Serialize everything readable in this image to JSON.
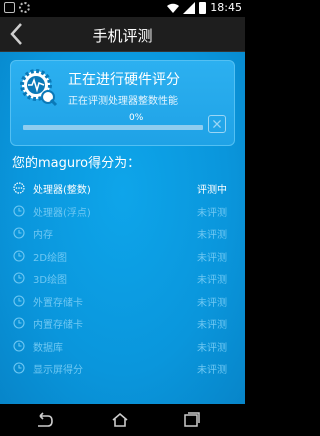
{
  "status_bar": {
    "time": "18:45"
  },
  "header": {
    "title": "手机评测"
  },
  "progress_card": {
    "heading": "正在进行硬件评分",
    "subheading": "正在评测处理器整数性能",
    "progress_label": "0%",
    "progress_value": 0
  },
  "score_text": "您的maguro得分为：",
  "items": [
    {
      "label": "处理器(整数)",
      "status": "评测中"
    },
    {
      "label": "处理器(浮点)",
      "status": "未评测"
    },
    {
      "label": "内存",
      "status": "未评测"
    },
    {
      "label": "2D绘图",
      "status": "未评测"
    },
    {
      "label": "3D绘图",
      "status": "未评测"
    },
    {
      "label": "外置存储卡",
      "status": "未评测"
    },
    {
      "label": "内置存储卡",
      "status": "未评测"
    },
    {
      "label": "数据库",
      "status": "未评测"
    },
    {
      "label": "显示屏得分",
      "status": "未评测"
    }
  ],
  "colors": {
    "content_bg": "#0a96dc",
    "active_text": "#ffffff",
    "inactive_text": "#6fc8f3"
  }
}
